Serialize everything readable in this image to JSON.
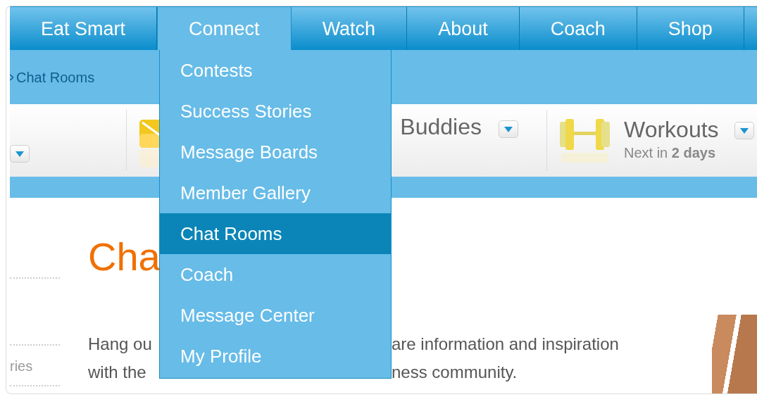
{
  "nav": {
    "tabs": [
      {
        "label": "Eat Smart",
        "selected": false
      },
      {
        "label": "Connect",
        "selected": true
      },
      {
        "label": "Watch",
        "selected": false
      },
      {
        "label": "About",
        "selected": false
      },
      {
        "label": "Coach",
        "selected": false
      },
      {
        "label": "Shop",
        "selected": false
      }
    ]
  },
  "breadcrumb": {
    "current": "Chat Rooms"
  },
  "toolbar": {
    "widgets": [
      {
        "kind": "plain"
      },
      {
        "kind": "mail",
        "title": "Buddies"
      },
      {
        "kind": "workout",
        "title": "Workouts",
        "subtitle": "Next in **2 days**"
      }
    ]
  },
  "sidebar": {
    "items": [
      {
        "label": "ries"
      }
    ]
  },
  "main": {
    "heading": "Cha",
    "intro_lines": [
      {
        "left": "Hang ou",
        "right": "are information and inspiration"
      },
      {
        "left": "with the",
        "right": "ness community."
      }
    ]
  },
  "menu": {
    "items": [
      {
        "label": "Contests",
        "selected": false
      },
      {
        "label": "Success Stories",
        "selected": false
      },
      {
        "label": "Message Boards",
        "selected": false
      },
      {
        "label": "Member Gallery",
        "selected": false
      },
      {
        "label": "Chat Rooms",
        "selected": true
      },
      {
        "label": "Coach",
        "selected": false
      },
      {
        "label": "Message Center",
        "selected": false
      },
      {
        "label": "My Profile",
        "selected": false
      }
    ]
  }
}
